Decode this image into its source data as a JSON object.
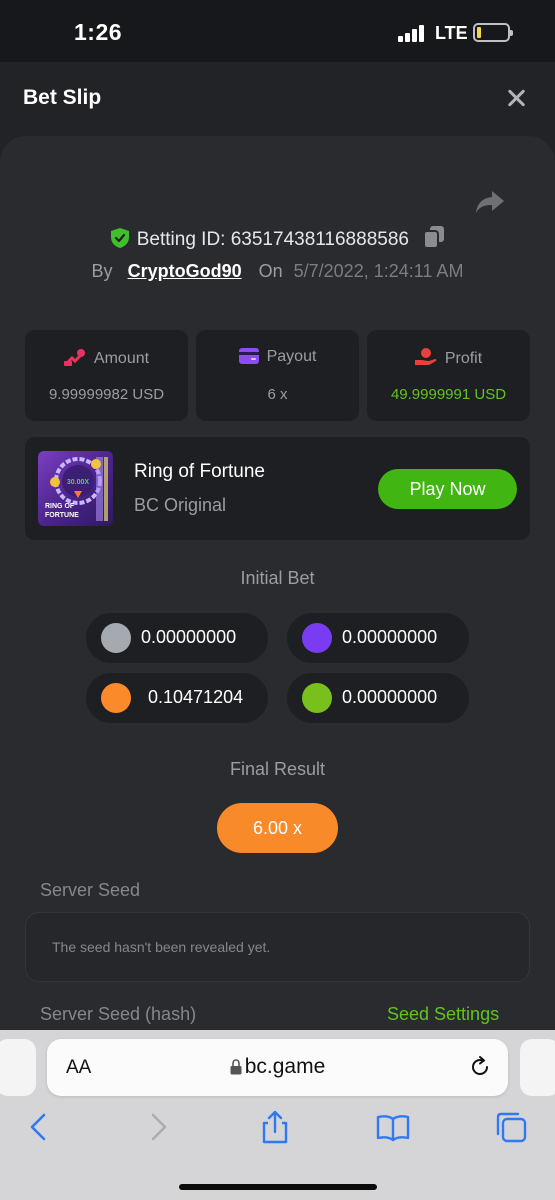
{
  "status_bar": {
    "time": "1:26",
    "network": "LTE"
  },
  "header": {
    "title": "Bet Slip"
  },
  "bet": {
    "betting_id_label": "Betting ID:",
    "betting_id": "63517438116888586",
    "by_label": "By",
    "username": "CryptoGod90",
    "on_label": "On",
    "date": "5/7/2022, 1:24:11 AM"
  },
  "stats": {
    "amount_label": "Amount",
    "amount_value": "9.99999982 USD",
    "payout_label": "Payout",
    "payout_value": "6 x",
    "profit_label": "Profit",
    "profit_value": "49.9999991 USD"
  },
  "game": {
    "name": "Ring of Fortune",
    "subtitle": "BC Original",
    "play_label": "Play Now",
    "thumb_multiplier": "30.00X",
    "thumb_title_line1": "RING OF",
    "thumb_title_line2": "FORTUNE"
  },
  "initial_bet": {
    "label": "Initial Bet",
    "chips": [
      {
        "color": "#a5aab0",
        "value": "0.00000000"
      },
      {
        "color": "#7a3cf2",
        "value": "0.00000000"
      },
      {
        "color": "#fb8a2b",
        "value": "0.10471204"
      },
      {
        "color": "#78c11c",
        "value": "0.00000000"
      }
    ]
  },
  "final_result": {
    "label": "Final Result",
    "value": "6.00 x"
  },
  "server_seed": {
    "label": "Server Seed",
    "message": "The seed hasn't been revealed yet.",
    "hash_label": "Server Seed (hash)",
    "settings_link": "Seed Settings"
  },
  "browser": {
    "aa_label": "AA",
    "url": "bc.game"
  },
  "colors": {
    "accent_green": "#41b512",
    "accent_orange": "#f88a2a"
  }
}
